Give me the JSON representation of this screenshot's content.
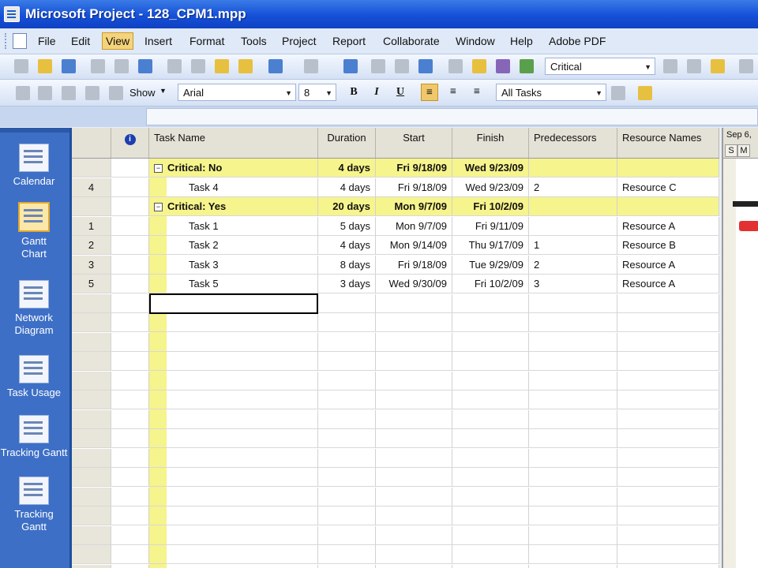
{
  "window": {
    "title": "Microsoft Project - 128_CPM1.mpp"
  },
  "menu": [
    "File",
    "Edit",
    "View",
    "Insert",
    "Format",
    "Tools",
    "Project",
    "Report",
    "Collaborate",
    "Window",
    "Help",
    "Adobe PDF"
  ],
  "toolbar": {
    "filter_value": "Critical",
    "show_label": "Show",
    "font_value": "Arial",
    "size_value": "8",
    "bold": "B",
    "italic": "I",
    "underline": "U",
    "alltasks_value": "All Tasks"
  },
  "viewbar": [
    "Calendar",
    "Gantt Chart",
    "Network Diagram",
    "Task Usage",
    "Tracking Gantt",
    "Tracking Gantt"
  ],
  "grid": {
    "columns": [
      "Task Name",
      "Duration",
      "Start",
      "Finish",
      "Predecessors",
      "Resource Names"
    ],
    "info_icon": "i",
    "rows": [
      {
        "id": "",
        "name": "Critical: No",
        "duration": "4 days",
        "start": "Fri 9/18/09",
        "finish": "Wed 9/23/09",
        "pred": "",
        "res": "",
        "group": true
      },
      {
        "id": "4",
        "name": "Task 4",
        "duration": "4 days",
        "start": "Fri 9/18/09",
        "finish": "Wed 9/23/09",
        "pred": "2",
        "res": "Resource C",
        "group": false
      },
      {
        "id": "",
        "name": "Critical: Yes",
        "duration": "20 days",
        "start": "Mon 9/7/09",
        "finish": "Fri 10/2/09",
        "pred": "",
        "res": "",
        "group": true
      },
      {
        "id": "1",
        "name": "Task 1",
        "duration": "5 days",
        "start": "Mon 9/7/09",
        "finish": "Fri 9/11/09",
        "pred": "",
        "res": "Resource A",
        "group": false
      },
      {
        "id": "2",
        "name": "Task 2",
        "duration": "4 days",
        "start": "Mon 9/14/09",
        "finish": "Thu 9/17/09",
        "pred": "1",
        "res": "Resource B",
        "group": false
      },
      {
        "id": "3",
        "name": "Task 3",
        "duration": "8 days",
        "start": "Fri 9/18/09",
        "finish": "Tue 9/29/09",
        "pred": "2",
        "res": "Resource A",
        "group": false
      },
      {
        "id": "5",
        "name": "Task 5",
        "duration": "3 days",
        "start": "Wed 9/30/09",
        "finish": "Fri 10/2/09",
        "pred": "3",
        "res": "Resource A",
        "group": false
      }
    ]
  },
  "gantt": {
    "date_label": "Sep 6,",
    "days": [
      "S",
      "M"
    ]
  },
  "colors": {
    "group_yellow": "#f6f48c",
    "critical_bar": "#e33030",
    "title_blue": "#1550d8"
  }
}
